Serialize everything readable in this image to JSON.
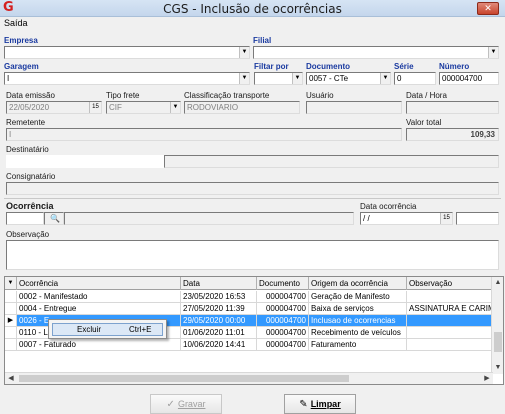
{
  "window": {
    "title": "CGS - Inclusão de ocorrências",
    "close_label": "✕"
  },
  "menu": {
    "saida": "Saída"
  },
  "labels": {
    "empresa": "Empresa",
    "filial": "Filial",
    "garagem": "Garagem",
    "filtrar_por": "Filtar por",
    "documento": "Documento",
    "serie": "Série",
    "numero": "Número",
    "data_emissao": "Data emissão",
    "tipo_frete": "Tipo frete",
    "classificacao_transporte": "Classificação transporte",
    "usuario": "Usuário",
    "data_hora": "Data / Hora",
    "remetente": "Remetente",
    "valor_total": "Valor total",
    "destinatario": "Destinatário",
    "consignatario": "Consignatário",
    "ocorrencia": "Ocorrência",
    "data_ocorrencia": "Data ocorrência",
    "observacao": "Observação"
  },
  "fields": {
    "garagem_value": "I",
    "documento_value": "0057 - CTe",
    "serie_value": "0",
    "numero_value": "000004700",
    "data_emissao_value": "22/05/2020",
    "tipo_frete_value": "CIF",
    "classificacao_value": "RODOVIARIO",
    "remetente_value": "I",
    "valor_total_value": "109,33",
    "data_ocorrencia_value": "/ /"
  },
  "grid": {
    "columns": [
      "Ocorrência",
      "Data",
      "Documento",
      "Origem da ocorrência",
      "Observação"
    ],
    "rows": [
      {
        "ocorrencia": "0002 - Manifestado",
        "data": "23/05/2020 16:53",
        "documento": "000004700",
        "origem": "Geração de Manifesto",
        "obs": ""
      },
      {
        "ocorrencia": "0004 - Entregue",
        "data": "27/05/2020 11:39",
        "documento": "000004700",
        "origem": "Baixa de serviços",
        "obs": "ASSINATURA E CARIM"
      },
      {
        "ocorrencia": "0026 - E",
        "data": "29/05/2020 00:00",
        "documento": "000004700",
        "origem": "Inclusao de ocorrencias",
        "obs": ""
      },
      {
        "ocorrencia": "0110 - Li...",
        "data": "01/06/2020 11:01",
        "documento": "000004700",
        "origem": "Recebimento de veículos",
        "obs": ""
      },
      {
        "ocorrencia": "0007 - Faturado",
        "data": "10/06/2020 14:41",
        "documento": "000004700",
        "origem": "Faturamento",
        "obs": ""
      }
    ]
  },
  "context_menu": {
    "label": "Excluir",
    "shortcut": "Ctrl+E"
  },
  "buttons": {
    "gravar": "Gravar",
    "limpar": "Limpar"
  }
}
